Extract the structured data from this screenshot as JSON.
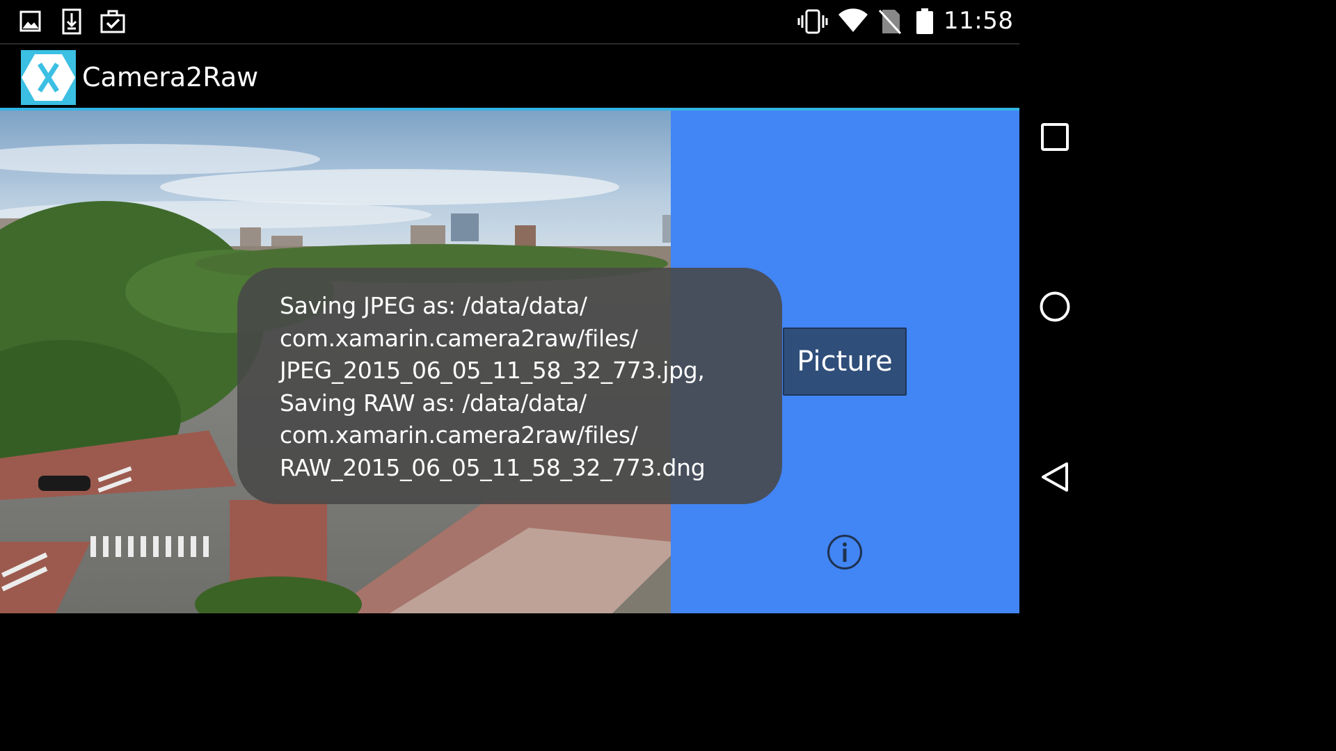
{
  "status_bar": {
    "left_icons": [
      "gallery-icon",
      "download-icon",
      "clipboard-check-icon"
    ],
    "right_icons": [
      "vibrate-icon",
      "wifi-icon",
      "no-sim-icon",
      "battery-icon"
    ],
    "time": "11:58"
  },
  "action_bar": {
    "logo_icon": "xamarin-logo-icon",
    "title": "Camera2Raw"
  },
  "colors": {
    "accent_line": "#33b5e5",
    "logo_bg": "#3bbfe3",
    "controls_panel_bg": "#4285f4",
    "picture_button_bg": "#2f4e7a",
    "toast_bg": "#484848"
  },
  "camera_preview": {
    "description_icon": "camera-preview-image"
  },
  "controls": {
    "picture_label": "Picture",
    "info_icon": "info-icon"
  },
  "toast": {
    "lines": [
      "Saving JPEG as: /data/data/",
      "com.xamarin.camera2raw/files/",
      "JPEG_2015_06_05_11_58_32_773.jpg,",
      "Saving RAW as: /data/data/",
      "com.xamarin.camera2raw/files/",
      "RAW_2015_06_05_11_58_32_773.dng"
    ]
  },
  "nav_bar": {
    "buttons": [
      "recents-icon",
      "home-icon",
      "back-icon"
    ]
  }
}
